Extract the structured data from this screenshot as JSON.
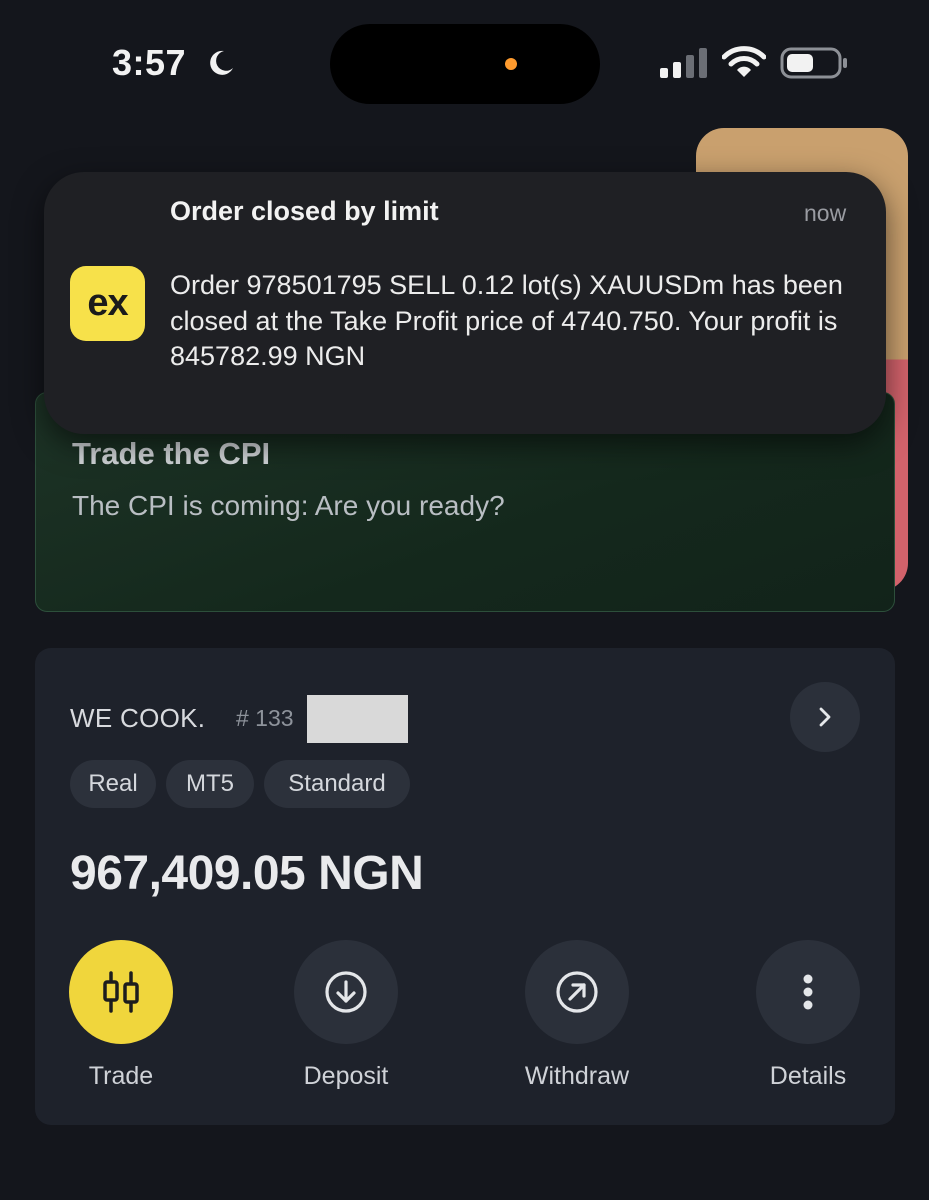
{
  "status_bar": {
    "time": "3:57",
    "icons": [
      "moon-icon",
      "signal-icon",
      "wifi-icon",
      "battery-icon"
    ]
  },
  "notification": {
    "title": "Order closed by limit",
    "time": "now",
    "app_icon_text": "ex",
    "body": "Order 978501795 SELL 0.12 lot(s) XAUUSDm has been closed at the Take Profit price of 4740.750. Your profit is 845782.99 NGN"
  },
  "promo": {
    "title": "Trade the CPI",
    "subtitle": "The CPI is coming: Are you ready?"
  },
  "account": {
    "name": "WE COOK.",
    "number_prefix": "# 133",
    "tags": [
      "Real",
      "MT5",
      "Standard"
    ],
    "balance": "967,409.05 NGN",
    "actions": [
      {
        "label": "Trade",
        "icon": "candlestick-icon"
      },
      {
        "label": "Deposit",
        "icon": "arrow-down-circle-icon"
      },
      {
        "label": "Withdraw",
        "icon": "arrow-up-right-circle-icon"
      },
      {
        "label": "Details",
        "icon": "more-vertical-icon"
      }
    ]
  },
  "colors": {
    "background": "#14161c",
    "card": "#1e222b",
    "accent": "#f0d63c",
    "promo_green": "#1d3326",
    "notification": "#1f2024"
  }
}
